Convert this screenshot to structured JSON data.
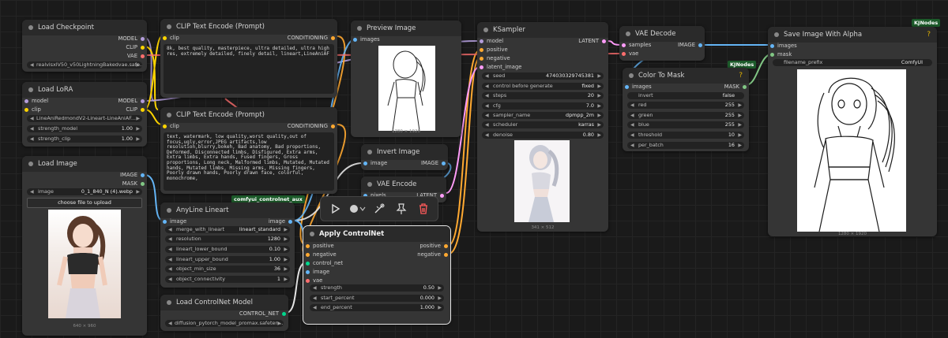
{
  "badges": {
    "controlnet_aux": "comfyui_controlnet_aux",
    "kjnodes_top": "KJNodes",
    "kjnodes_mask": "KJNodes"
  },
  "load_checkpoint": {
    "title": "Load Checkpoint",
    "out_model": "MODEL",
    "out_clip": "CLIP",
    "out_vae": "VAE",
    "ckpt_value": "realvisxlV50_v50LightningBakedvae.safe..."
  },
  "load_lora": {
    "title": "Load LoRA",
    "in_model": "model",
    "in_clip": "clip",
    "out_model": "MODEL",
    "out_clip": "CLIP",
    "lora_value": "LineAniRedmondV2-Lineart-LineAniAF...",
    "strength_model_label": "strength_model",
    "strength_model_value": "1.00",
    "strength_clip_label": "strength_clip",
    "strength_clip_value": "1.00"
  },
  "load_image": {
    "title": "Load Image",
    "out_image": "IMAGE",
    "out_mask": "MASK",
    "image_label": "image",
    "image_value": "0_1_840_N (4).webp",
    "upload_label": "choose file to upload",
    "caption": "640 × 960"
  },
  "clip_pos": {
    "title": "CLIP Text Encode (Prompt)",
    "in_clip": "clip",
    "out": "CONDITIONING",
    "text": "8k, best quality, masterpiece, ultra detailed, ultra high res, extremely detailed, finely detail, lineart,LineAniAF"
  },
  "clip_neg": {
    "title": "CLIP Text Encode (Prompt)",
    "in_clip": "clip",
    "out": "CONDITIONING",
    "text": "text, watermark, low quality,worst quality,out of focus,ugly,error,JPEG artifacts,low resolution,blurry,bokeh, Bad anatomy, Bad proportions, Deformed, Disconnected limbs, Disfigured, Extra arms, Extra limbs, Extra hands, Fused fingers, Gross proportions, Long neck, Malformed limbs, Mutated, Mutated hands, Mutated limbs, Missing arms, Missing fingers, Poorly drawn hands, Poorly drawn face, colorful, monochrome,"
  },
  "preview": {
    "title": "Preview Image",
    "in_images": "images",
    "caption": "1280 × 1920"
  },
  "invert": {
    "title": "Invert Image",
    "in_image": "image",
    "out_image": "IMAGE"
  },
  "vae_encode": {
    "title": "VAE Encode",
    "in_pixels": "pixels",
    "out_latent": "LATENT"
  },
  "anyline": {
    "title": "AnyLine Lineart",
    "in_image": "image",
    "out_image": "image",
    "widgets": [
      {
        "label": "merge_with_lineart",
        "value": "lineart_standard"
      },
      {
        "label": "resolution",
        "value": "1280"
      },
      {
        "label": "lineart_lower_bound",
        "value": "0.10"
      },
      {
        "label": "lineart_upper_bound",
        "value": "1.00"
      },
      {
        "label": "object_min_size",
        "value": "36"
      },
      {
        "label": "object_connectivity",
        "value": "1"
      }
    ]
  },
  "controlnet_loader": {
    "title": "Load ControlNet Model",
    "out": "CONTROL_NET",
    "value": "diffusion_pytorch_model_promax.safeten..."
  },
  "apply_cn": {
    "title": "Apply ControlNet",
    "inputs": [
      "positive",
      "negative",
      "control_net",
      "image",
      "vae"
    ],
    "out_positive": "positive",
    "out_negative": "negative",
    "widgets": [
      {
        "label": "strength",
        "value": "0.50"
      },
      {
        "label": "start_percent",
        "value": "0.000"
      },
      {
        "label": "end_percent",
        "value": "1.000"
      }
    ]
  },
  "ksampler": {
    "title": "KSampler",
    "inputs": [
      "model",
      "positive",
      "negative",
      "latent_image"
    ],
    "out": "LATENT",
    "widgets": [
      {
        "label": "seed",
        "value": "474030329745381"
      },
      {
        "label": "control before generate",
        "value": "fixed"
      },
      {
        "label": "steps",
        "value": "20"
      },
      {
        "label": "cfg",
        "value": "7.0"
      },
      {
        "label": "sampler_name",
        "value": "dpmpp_2m"
      },
      {
        "label": "scheduler",
        "value": "karras"
      },
      {
        "label": "denoise",
        "value": "0.80"
      }
    ],
    "caption": "341 × 512"
  },
  "vae_decode": {
    "title": "VAE Decode",
    "in_samples": "samples",
    "in_vae": "vae",
    "out": "IMAGE"
  },
  "color_mask": {
    "title": "Color To Mask",
    "help": "?",
    "in_images": "images",
    "out": "MASK",
    "widgets": [
      {
        "label": "invert",
        "value": "false"
      },
      {
        "label": "red",
        "value": "255"
      },
      {
        "label": "green",
        "value": "255"
      },
      {
        "label": "blue",
        "value": "255"
      },
      {
        "label": "threshold",
        "value": "10"
      },
      {
        "label": "per_batch",
        "value": "16"
      }
    ]
  },
  "save_alpha": {
    "title": "Save Image With Alpha",
    "help": "?",
    "in_images": "images",
    "in_mask": "mask",
    "prefix_label": "filename_prefix",
    "prefix_value": "ComfyUI",
    "caption": "1280 × 1920"
  },
  "colors": {
    "model": "#b39ddb",
    "clip": "#ffd500",
    "vae": "#ff6e6e",
    "conditioning": "#ffa931",
    "image": "#64b5f6",
    "latent": "#ff9cf9",
    "mask": "#81c784",
    "control_net": "#00d78d"
  }
}
